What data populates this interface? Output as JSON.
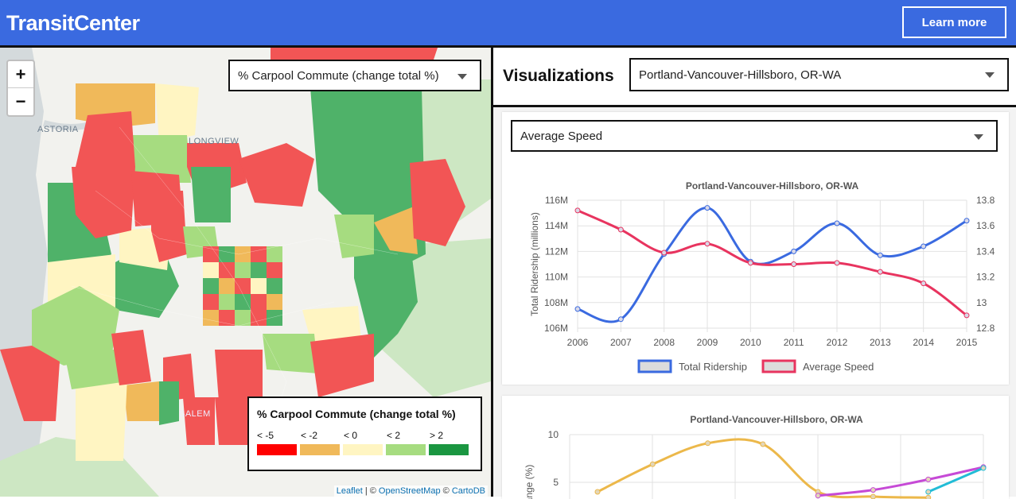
{
  "header": {
    "brand": "TransitCenter",
    "learn_more": "Learn more"
  },
  "map": {
    "zoom_in": "+",
    "zoom_out": "−",
    "layer_select": "% Carpool Commute (change total %)",
    "places": {
      "astoria": "ASTORIA",
      "longview": "LONGVIEW",
      "salem": "SALEM"
    },
    "legend": {
      "title": "% Carpool Commute (change total %)",
      "items": [
        {
          "label": "< -5",
          "color": "#ff0000"
        },
        {
          "label": "< -2",
          "color": "#f0b95a"
        },
        {
          "label": "< 0",
          "color": "#fff5c2"
        },
        {
          "label": "< 2",
          "color": "#a6dc80"
        },
        {
          "label": "> 2",
          "color": "#1a9641"
        }
      ]
    },
    "attribution": {
      "leaflet": "Leaflet",
      "sep": "| ©",
      "osm": "OpenStreetMap",
      "amp": "©",
      "carto": "CartoDB"
    }
  },
  "viz": {
    "title": "Visualizations",
    "region_select": "Portland-Vancouver-Hillsboro, OR-WA",
    "metric_select": "Average Speed"
  },
  "chart_data": [
    {
      "type": "line",
      "title": "Portland-Vancouver-Hillsboro, OR-WA",
      "x": [
        "2006",
        "2007",
        "2008",
        "2009",
        "2010",
        "2011",
        "2012",
        "2013",
        "2014",
        "2015"
      ],
      "ylabel": "Total Ridership (millions)",
      "ylim": [
        106,
        116
      ],
      "y_ticks": [
        "106M",
        "108M",
        "110M",
        "112M",
        "114M",
        "116M"
      ],
      "y2lim": [
        12.8,
        13.8
      ],
      "y2_ticks": [
        "12.8",
        "13",
        "13.2",
        "13.4",
        "13.6",
        "13.8"
      ],
      "series": [
        {
          "name": "Total Ridership",
          "color": "#3a6ae0",
          "axis": "left",
          "values": [
            107.5,
            106.7,
            111.8,
            115.4,
            111.2,
            112.0,
            114.2,
            111.7,
            112.4,
            114.4
          ]
        },
        {
          "name": "Average Speed",
          "color": "#e8345f",
          "axis": "right",
          "values": [
            13.72,
            13.57,
            13.39,
            13.46,
            13.31,
            13.3,
            13.31,
            13.24,
            13.15,
            12.9
          ]
        }
      ],
      "legend_position": "bottom",
      "grid": true
    },
    {
      "type": "line",
      "title": "Portland-Vancouver-Hillsboro, OR-WA",
      "ylabel_visible": "ange (%)",
      "y_ticks": [
        "10",
        "5"
      ],
      "ylim_visible": [
        0,
        10
      ],
      "series": [
        {
          "color": "#ecb84a",
          "values": [
            4.0,
            6.9,
            9.1,
            9.0,
            4.0,
            3.5,
            3.4,
            null
          ]
        },
        {
          "color": "#c64ad6",
          "values": [
            null,
            null,
            null,
            null,
            3.6,
            4.2,
            5.3,
            6.6
          ]
        },
        {
          "color": "#22bcd6",
          "values": [
            null,
            null,
            null,
            null,
            null,
            null,
            4.0,
            6.5
          ]
        }
      ]
    }
  ]
}
